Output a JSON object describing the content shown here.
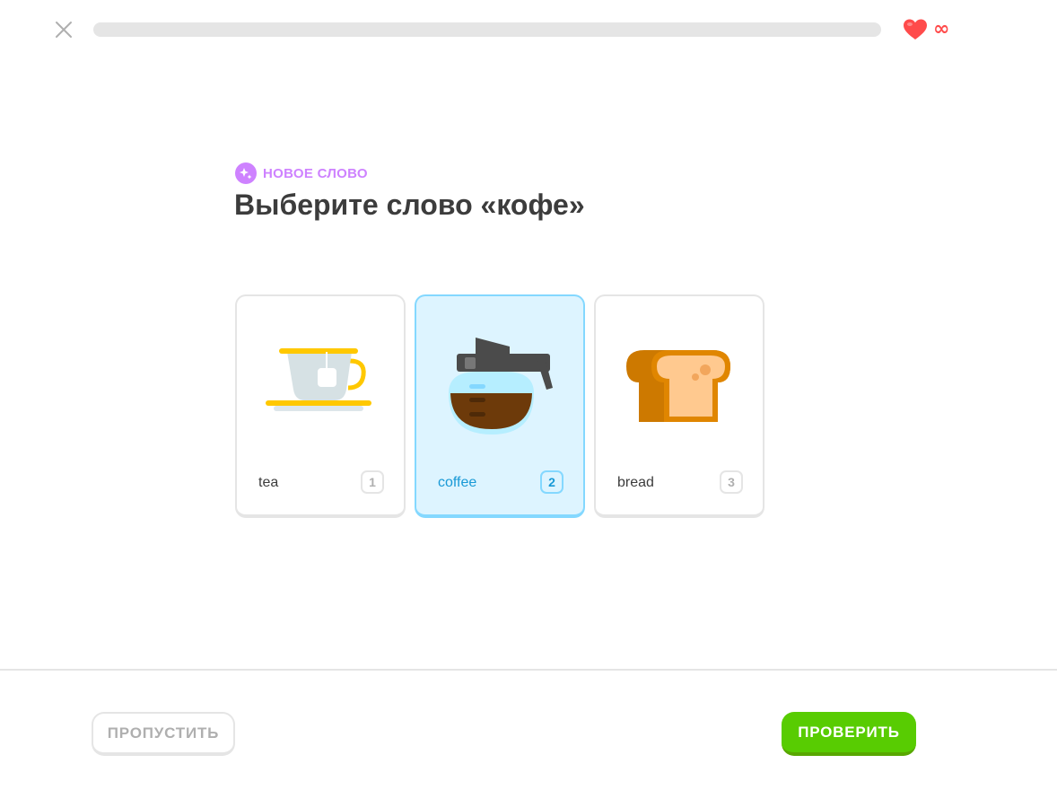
{
  "header": {
    "close_icon": "close-icon",
    "progress": 0,
    "hearts_icon": "heart-icon",
    "hearts_value": "∞",
    "colors": {
      "heart": "#ff4b4b",
      "progress_track": "#e5e5e5"
    }
  },
  "challenge": {
    "badge_icon": "new-word-icon",
    "badge_label": "НОВОЕ СЛОВО",
    "title": "Выберите слово «кофе»",
    "colors": {
      "badge": "#ce82ff"
    }
  },
  "choices": [
    {
      "label": "tea",
      "key": "1",
      "icon": "tea-cup-icon",
      "selected": false
    },
    {
      "label": "coffee",
      "key": "2",
      "icon": "coffee-pot-icon",
      "selected": true
    },
    {
      "label": "bread",
      "key": "3",
      "icon": "bread-icon",
      "selected": false
    }
  ],
  "footer": {
    "skip_label": "ПРОПУСТИТЬ",
    "check_label": "ПРОВЕРИТЬ",
    "colors": {
      "check_button": "#58cc02"
    }
  }
}
